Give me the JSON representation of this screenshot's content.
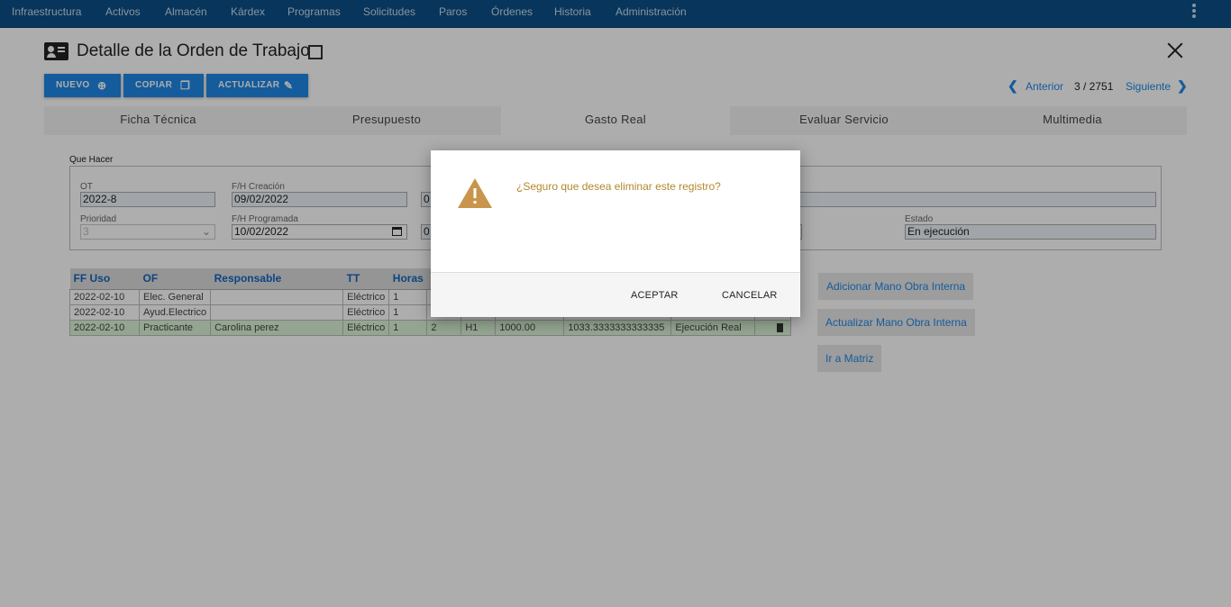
{
  "topnav": {
    "items": [
      "Infraestructura",
      "Activos",
      "Almacén",
      "Kárdex",
      "Programas",
      "Solicitudes",
      "Paros",
      "Órdenes",
      "Historia",
      "Administración"
    ]
  },
  "header": {
    "title": "Detalle de la Orden de Trabajo"
  },
  "toolbar": {
    "nuevo": "NUEVO",
    "copiar": "COPIAR",
    "actualizar": "ACTUALIZAR"
  },
  "pager": {
    "prev": "Anterior",
    "position": "3 / 2751",
    "next": "Siguiente"
  },
  "tabs": [
    "Ficha Técnica",
    "Presupuesto",
    "Gasto Real",
    "Evaluar Servicio",
    "Multimedia"
  ],
  "active_tab": "Gasto Real",
  "form": {
    "group_label": "Que Hacer",
    "ot_label": "OT",
    "ot_value": "2022-8",
    "fh_creacion_label": "F/H Creación",
    "fh_creacion_value": "09/02/2022",
    "col3_value_1": "0",
    "prioridad_label": "Prioridad",
    "prioridad_value": "3",
    "fh_programada_label": "F/H Programada",
    "fh_programada_value": "10/02/2022",
    "col3_value_2": "0",
    "estado_label": "Estado",
    "estado_value": "En ejecución"
  },
  "table": {
    "headers": [
      "FF Uso",
      "OF",
      "Responsable",
      "TT",
      "Horas"
    ],
    "rows": [
      {
        "ff_uso": "2022-02-10",
        "of": "Elec. General",
        "responsable": "",
        "tt": "Eléctrico",
        "horas": "1",
        "c6": "",
        "c7": "",
        "c8": "",
        "c9": "",
        "c10": ""
      },
      {
        "ff_uso": "2022-02-10",
        "of": "Ayud.Electrico",
        "responsable": "",
        "tt": "Eléctrico",
        "horas": "1",
        "c6": "",
        "c7": "",
        "c8": "",
        "c9": "",
        "c10": ""
      },
      {
        "ff_uso": "2022-02-10",
        "of": "Practicante",
        "responsable": "Carolina perez",
        "tt": "Eléctrico",
        "horas": "1",
        "c6": "2",
        "c7": "H1",
        "c8": "1000.00",
        "c9": "1033.3333333333335",
        "c10": "Ejecución Real"
      }
    ]
  },
  "side_buttons": {
    "adicionar": "Adicionar Mano Obra Interna",
    "actualizar": "Actualizar Mano Obra Interna",
    "matriz": "Ir a Matriz"
  },
  "dialog": {
    "message": "¿Seguro que desea eliminar este registro?",
    "accept": "ACEPTAR",
    "cancel": "CANCELAR",
    "icon": "warning-icon",
    "icon_color": "#c9954c"
  },
  "colors": {
    "nav_bg": "#0d4f86",
    "accent": "#1e88e5"
  }
}
